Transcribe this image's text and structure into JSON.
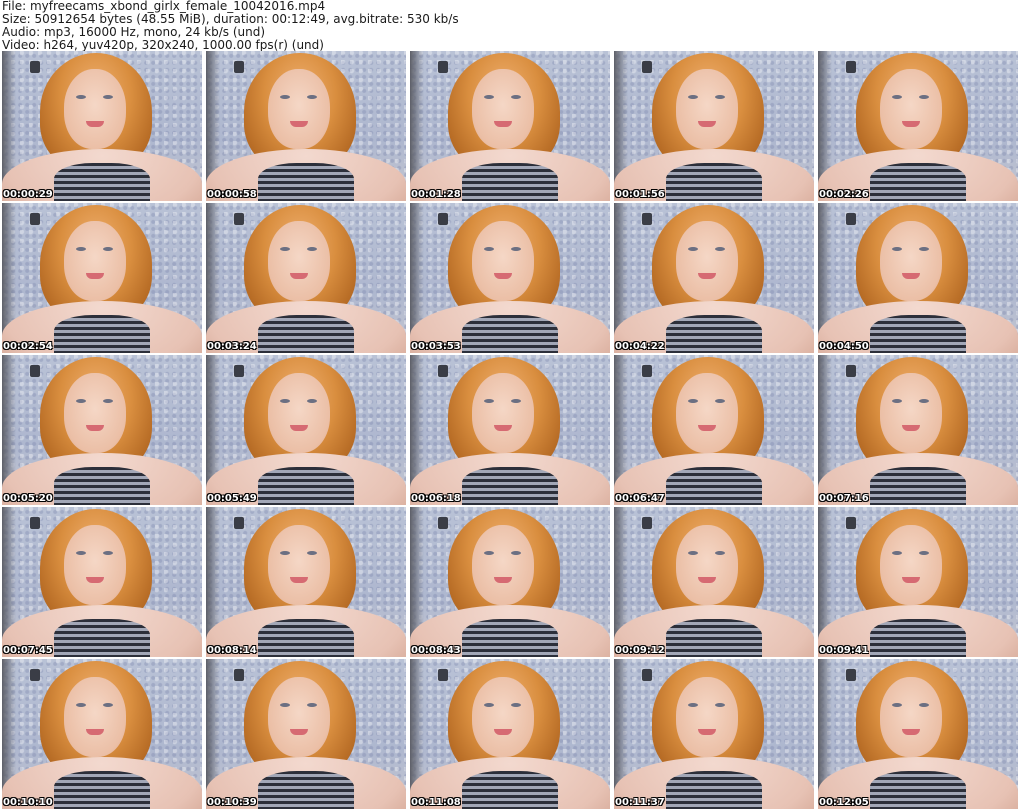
{
  "header": {
    "file": "File: myfreecams_xbond_girlx_female_10042016.mp4",
    "size": "Size: 50912654 bytes (48.55 MiB), duration: 00:12:49, avg.bitrate: 530 kb/s",
    "audio": "Audio: mp3, 16000 Hz, mono, 24 kb/s (und)",
    "video": "Video: h264, yuv420p, 320x240, 1000.00 fps(r) (und)"
  },
  "thumbnails": [
    "00:00:29",
    "00:00:58",
    "00:01:28",
    "00:01:56",
    "00:02:26",
    "00:02:54",
    "00:03:24",
    "00:03:53",
    "00:04:22",
    "00:04:50",
    "00:05:20",
    "00:05:49",
    "00:06:18",
    "00:06:47",
    "00:07:16",
    "00:07:45",
    "00:08:14",
    "00:08:43",
    "00:09:12",
    "00:09:41",
    "00:10:10",
    "00:10:39",
    "00:11:08",
    "00:11:37",
    "00:12:05"
  ]
}
